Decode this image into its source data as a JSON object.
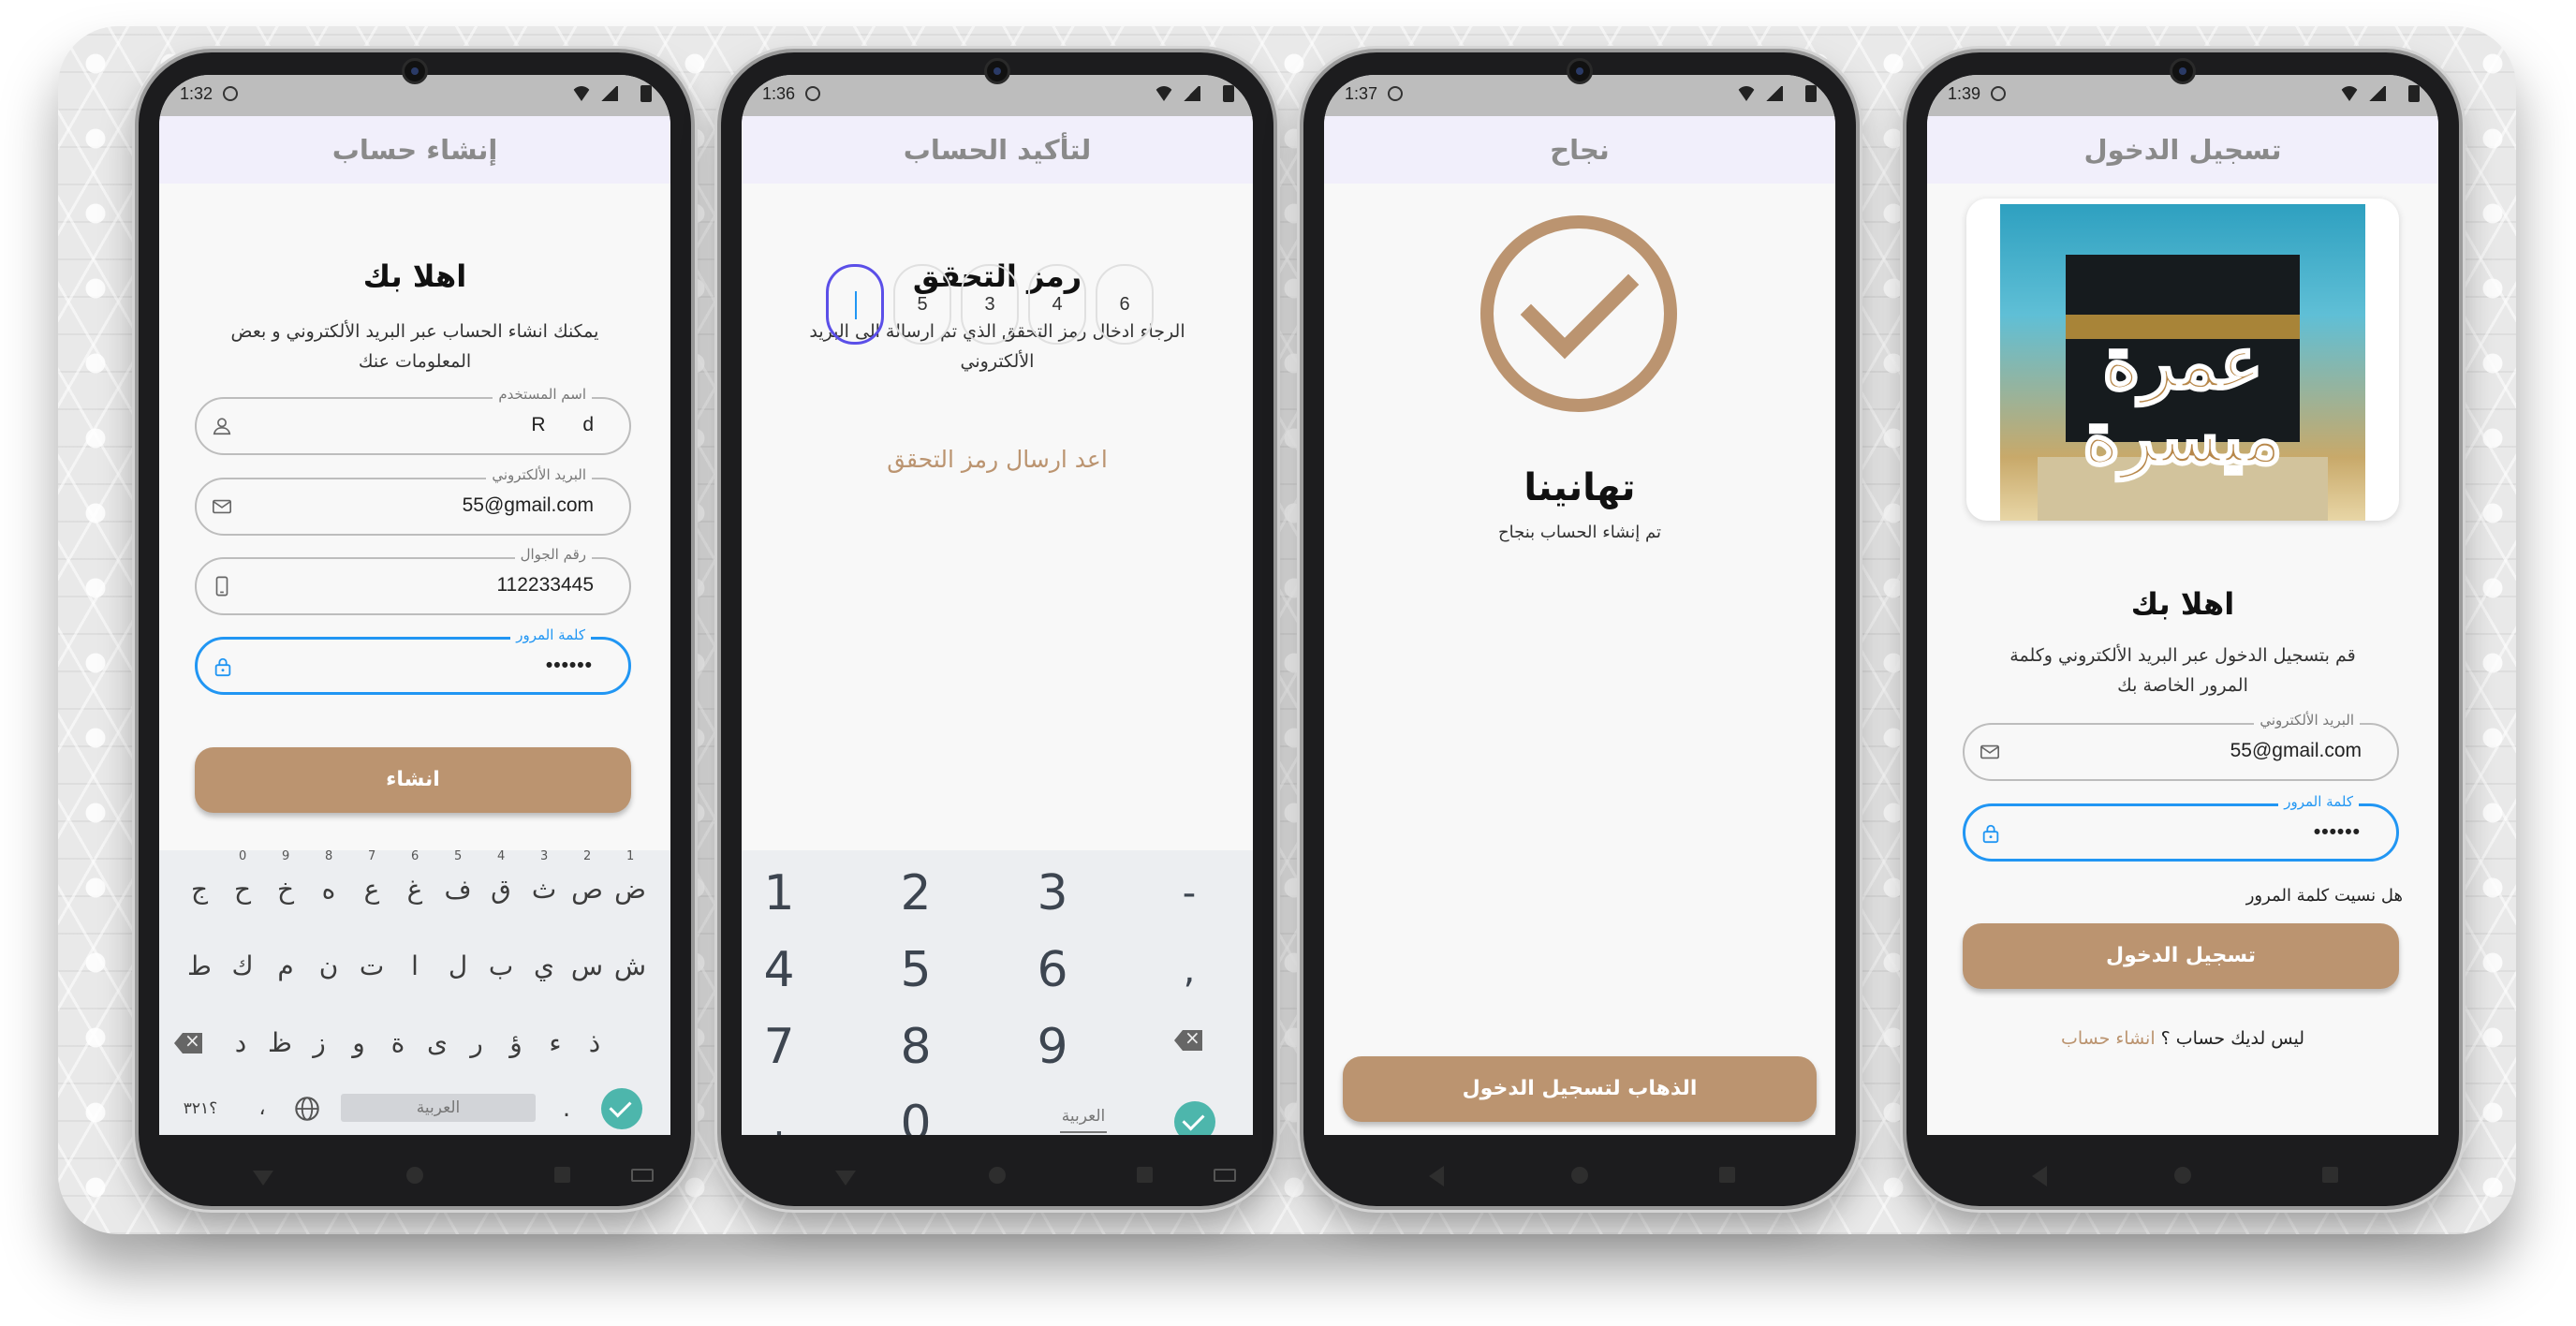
{
  "screens": {
    "signup": {
      "status_time": "1:32",
      "appbar_title": "إنشاء حساب",
      "heading": "اهلا بك",
      "description": "يمكنك انشاء الحساب عبر البريد الألكتروني و بعض المعلومات عنك",
      "fields": {
        "username": {
          "label": "اسم المستخدم",
          "value": "R d",
          "icon": "person-icon"
        },
        "email": {
          "label": "البريد الألكتروني",
          "value": "55@gmail.com",
          "icon": "mail-icon"
        },
        "phone": {
          "label": "رقم الجوال",
          "value": "112233445",
          "icon": "phone-icon"
        },
        "password": {
          "label": "كلمة المرور",
          "value": "••••••",
          "icon": "lock-icon"
        }
      },
      "submit_label": "انشاء",
      "keyboard": {
        "row1": [
          "ض",
          "ص",
          "ث",
          "ق",
          "ف",
          "غ",
          "ع",
          "ه",
          "خ",
          "ح",
          "ج"
        ],
        "row1_digits": [
          "1",
          "2",
          "3",
          "4",
          "5",
          "6",
          "7",
          "8",
          "9",
          "0",
          ""
        ],
        "row2": [
          "ش",
          "س",
          "ي",
          "ب",
          "ل",
          "ا",
          "ت",
          "ن",
          "م",
          "ك",
          "ط"
        ],
        "row3": [
          "ذ",
          "ء",
          "ؤ",
          "ر",
          "ى",
          "ة",
          "و",
          "ز",
          "ظ",
          "د"
        ],
        "symbols_key": "؟٣٢١",
        "comma_key": "،",
        "space_label": "العربية",
        "period_key": "."
      }
    },
    "verify": {
      "status_time": "1:36",
      "appbar_title": "لتأكيد الحساب",
      "heading": "رمز التحقق",
      "description": "الرجاء ادخال رمز التحقق الذي تم ارسالة الى البريد الألكتروني",
      "otp_digits": [
        "",
        "5",
        "3",
        "4",
        "6"
      ],
      "resend_label": "اعد ارسال رمز التحقق",
      "numpad": {
        "rows": [
          [
            "1",
            "2",
            "3",
            "-"
          ],
          [
            "4",
            "5",
            "6",
            ","
          ],
          [
            "7",
            "8",
            "9",
            ""
          ],
          [
            ".",
            "0",
            "",
            ""
          ]
        ],
        "space_label": "العربية"
      }
    },
    "success": {
      "status_time": "1:37",
      "appbar_title": "نجاح",
      "heading": "تهانينا",
      "message": "تم إنشاء الحساب بنجاح",
      "button_label": "الذهاب لتسجيل الدخول"
    },
    "login": {
      "status_time": "1:39",
      "appbar_title": "تسجيل الدخول",
      "logo_text": "عمرة ميسرة",
      "heading": "اهلا بك",
      "description": "قم بتسجيل الدخول عبر البريد الألكتروني وكلمة المرور الخاصة بك",
      "fields": {
        "email": {
          "label": "البريد الألكتروني",
          "value": "55@gmail.com",
          "icon": "mail-icon"
        },
        "password": {
          "label": "كلمة المرور",
          "value": "••••••",
          "icon": "lock-icon"
        }
      },
      "forgot_label": "هل نسيت كلمة المرور",
      "submit_label": "تسجيل الدخول",
      "no_account_label": "ليس لديك حساب ؟",
      "create_account_link": "انشاء حساب"
    }
  },
  "colors": {
    "primary": "#bb9470",
    "focus": "#2196f3",
    "appbar": "#f1effb",
    "keyboard": "#eceef1",
    "check": "#4db6ac"
  }
}
